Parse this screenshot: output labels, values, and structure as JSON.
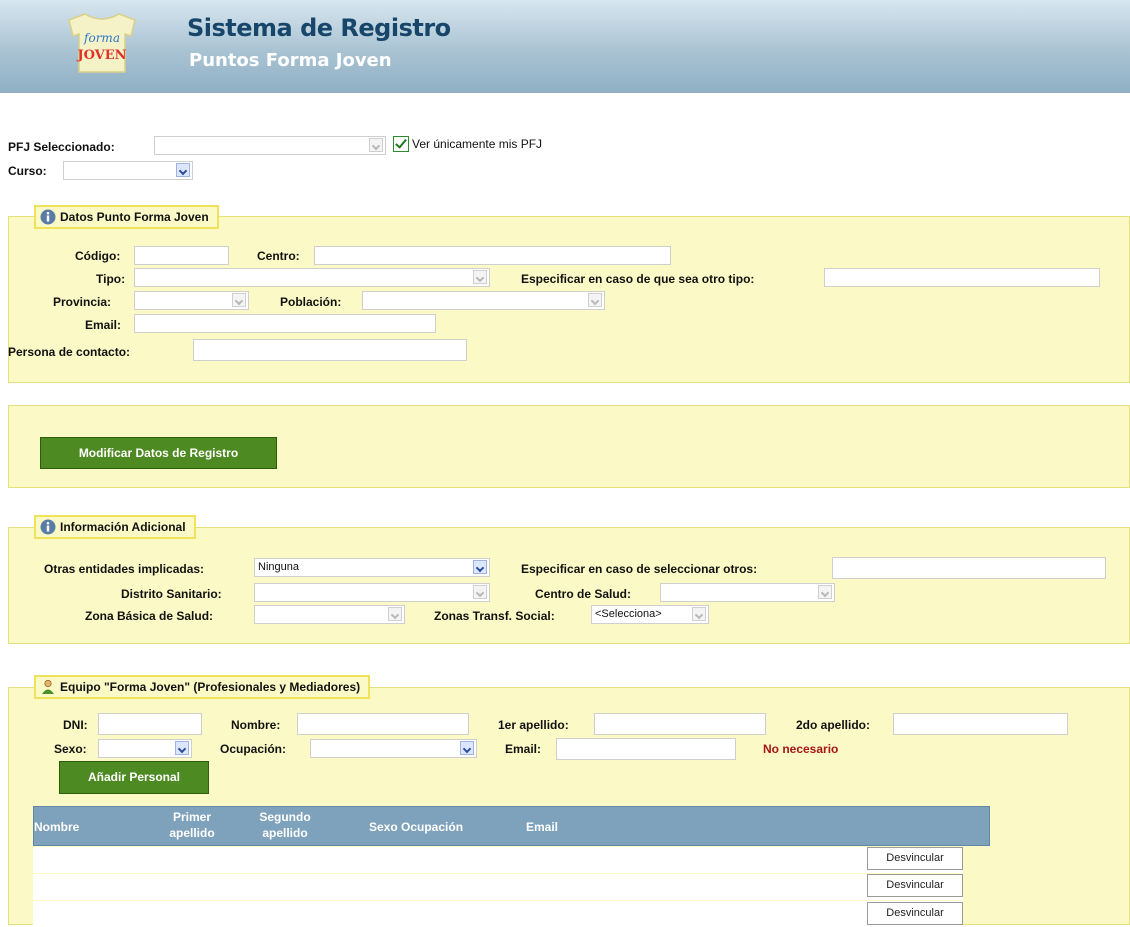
{
  "header": {
    "logo_text_top": "forma",
    "logo_text_bottom": "JOVEN",
    "title": "Sistema de Registro",
    "subtitle": "Puntos Forma Joven"
  },
  "top": {
    "pfj_label": "PFJ Seleccionado:",
    "pfj_value": "",
    "only_mine_label": "Ver únicamente mis PFJ",
    "only_mine_checked": true,
    "curso_label": "Curso:",
    "curso_value": ""
  },
  "datos": {
    "legend": "Datos Punto Forma Joven",
    "codigo_label": "Código:",
    "centro_label": "Centro:",
    "tipo_label": "Tipo:",
    "especificar_label": "Especificar en caso de que sea otro tipo:",
    "provincia_label": "Provincia:",
    "poblacion_label": "Población:",
    "email_label": "Email:",
    "contacto_label": "Persona de contacto:"
  },
  "modificar": {
    "button_label": "Modificar Datos de Registro"
  },
  "info": {
    "legend": "Información Adicional",
    "otras_label": "Otras entidades implicadas:",
    "otras_value": "Ninguna",
    "especificar_otros_label": "Especificar en caso de seleccionar otros:",
    "distrito_label": "Distrito Sanitario:",
    "centro_salud_label": "Centro de Salud:",
    "zona_basica_label": "Zona Básica de Salud:",
    "zonas_transf_label": "Zonas Transf. Social:",
    "zonas_transf_value": "<Selecciona>"
  },
  "equipo": {
    "legend": "Equipo \"Forma Joven\" (Profesionales y Mediadores)",
    "dni_label": "DNI:",
    "nombre_label": "Nombre:",
    "apellido1_label": "1er apellido:",
    "apellido2_label": "2do apellido:",
    "sexo_label": "Sexo:",
    "ocupacion_label": "Ocupación:",
    "email_label": "Email:",
    "email_note": "No necesario",
    "add_button": "Añadir Personal",
    "columns": {
      "nombre": "Nombre",
      "primer_1": "Primer",
      "primer_2": "apellido",
      "segundo_1": "Segundo",
      "segundo_2": "apellido",
      "sexo_ocupacion": "Sexo Ocupación",
      "email": "Email"
    },
    "row_action": "Desvincular"
  },
  "colors": {
    "header_blue": "#17466a",
    "panel_yellow": "#fbfac6",
    "button_green": "#4e8a22",
    "grid_head": "#7fa2bc",
    "note_red": "#a61616"
  }
}
